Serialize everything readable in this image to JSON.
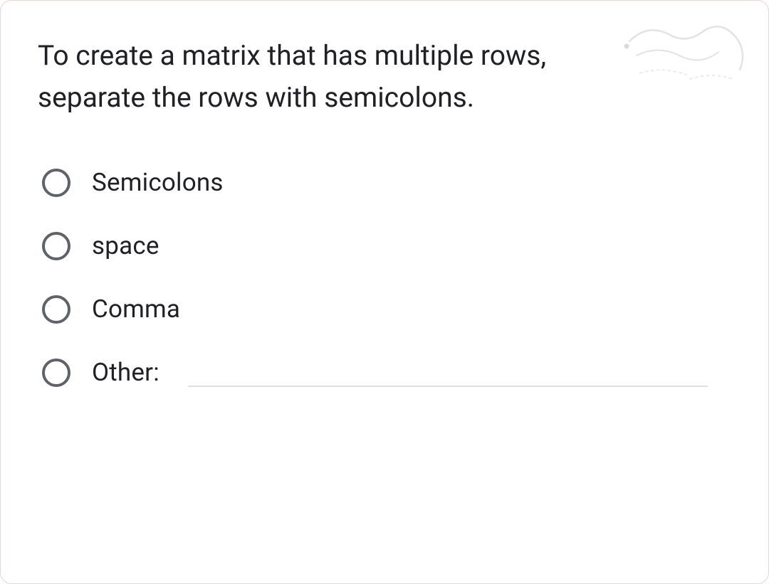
{
  "question": {
    "text": "To create a matrix that has multiple rows, separate the rows with semicolons."
  },
  "options": [
    {
      "label": "Semicolons"
    },
    {
      "label": "space"
    },
    {
      "label": "Comma"
    },
    {
      "label": "Other:"
    }
  ]
}
